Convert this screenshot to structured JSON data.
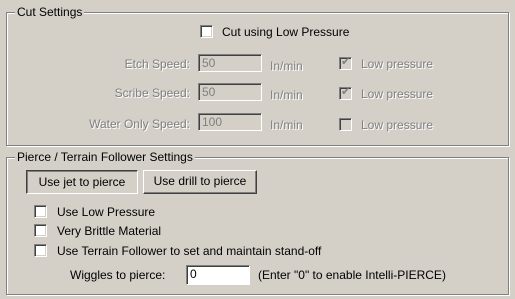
{
  "cut_settings": {
    "title": "Cut Settings",
    "low_pressure_label": "Cut using Low Pressure",
    "rows": [
      {
        "label": "Etch Speed:",
        "value": "50",
        "unit": "In/min",
        "checkbox_label": "Low pressure",
        "checked": true
      },
      {
        "label": "Scribe Speed:",
        "value": "50",
        "unit": "In/min",
        "checkbox_label": "Low pressure",
        "checked": true
      },
      {
        "label": "Water Only Speed:",
        "value": "100",
        "unit": "In/min",
        "checkbox_label": "Low pressure",
        "checked": false
      }
    ]
  },
  "pierce_settings": {
    "title": "Pierce / Terrain Follower Settings",
    "jet_button": "Use jet to pierce",
    "drill_button": "Use drill to pierce",
    "options": [
      "Use Low Pressure",
      "Very Brittle Material",
      "Use Terrain Follower to set and maintain stand-off"
    ],
    "wiggles_label": "Wiggles to pierce:",
    "wiggles_value": "0",
    "wiggles_hint": "(Enter \"0\" to enable Intelli-PIERCE)"
  }
}
